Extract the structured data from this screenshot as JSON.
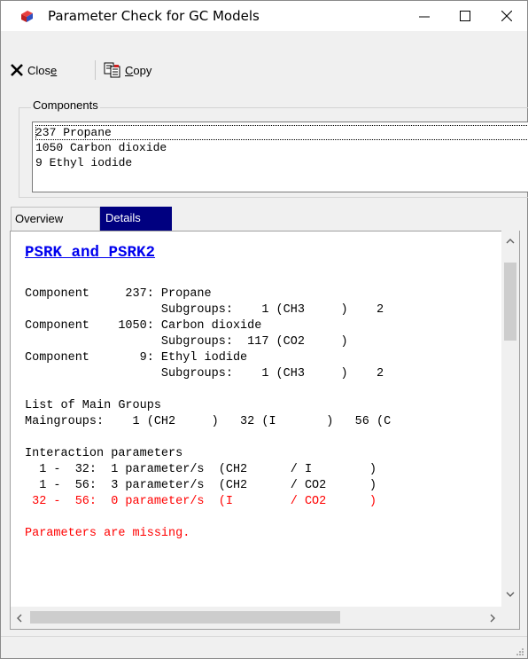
{
  "window": {
    "title": "Parameter Check for GC Models",
    "controls": {
      "minimize": "—",
      "maximize": "☐",
      "close": "✕"
    }
  },
  "toolbar": {
    "close_label": "Close",
    "copy_label": "Copy"
  },
  "components": {
    "label": "Components",
    "items": [
      "237 Propane",
      "1050 Carbon dioxide",
      "9 Ethyl iodide"
    ],
    "selected_index": 0
  },
  "tabs": {
    "overview": "Overview",
    "details": "Details",
    "active": "details"
  },
  "details": {
    "title": "PSRK and PSRK2",
    "lines": [
      "Component     237: Propane",
      "                   Subgroups:    1 (CH3     )    2",
      "Component    1050: Carbon dioxide",
      "                   Subgroups:  117 (CO2     )",
      "Component       9: Ethyl iodide",
      "                   Subgroups:    1 (CH3     )    2",
      "",
      "List of Main Groups",
      "Maingroups:    1 (CH2     )   32 (I       )   56 (C",
      "",
      "Interaction parameters",
      "  1 -  32:  1 parameter/s  (CH2      / I        )",
      "  1 -  56:  3 parameter/s  (CH2      / CO2      )",
      " 32 -  56:  0 parameter/s  (I        / CO2      )",
      "",
      "Parameters are missing."
    ],
    "error_color": "#ff0000",
    "title_color": "#0000ee"
  }
}
